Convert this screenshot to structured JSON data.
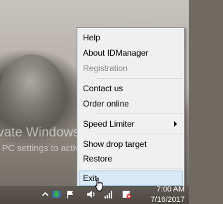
{
  "desktop": {
    "watermark_line1": "ivate Windows",
    "watermark_line2": "o PC settings to activate Windows."
  },
  "context_menu": {
    "items": [
      {
        "label": "Help",
        "enabled": true
      },
      {
        "label": "About IDManager",
        "enabled": true
      },
      {
        "label": "Registration",
        "enabled": false
      },
      {
        "label": "Contact us",
        "enabled": true
      },
      {
        "label": "Order online",
        "enabled": true
      },
      {
        "label": "Speed Limiter",
        "enabled": true,
        "submenu": true
      },
      {
        "label": "Show drop target",
        "enabled": true
      },
      {
        "label": "Restore",
        "enabled": true
      },
      {
        "label": "Exit",
        "enabled": true,
        "selected": true
      }
    ]
  },
  "taskbar": {
    "clock_time": "7:00 AM",
    "clock_date": "7/16/2017",
    "tray_icons": [
      "show-hidden-icons-icon",
      "idm-tray-icon",
      "flag-icon",
      "volume-icon",
      "network-icon",
      "action-center-icon"
    ]
  },
  "colors": {
    "menu_background": "#f0f0f0",
    "menu_border": "#979797",
    "selected_background": "#d8e8f7",
    "selected_border": "#99c3ea",
    "disabled_text": "#8d8d8d",
    "taskbar": "#514c46"
  }
}
